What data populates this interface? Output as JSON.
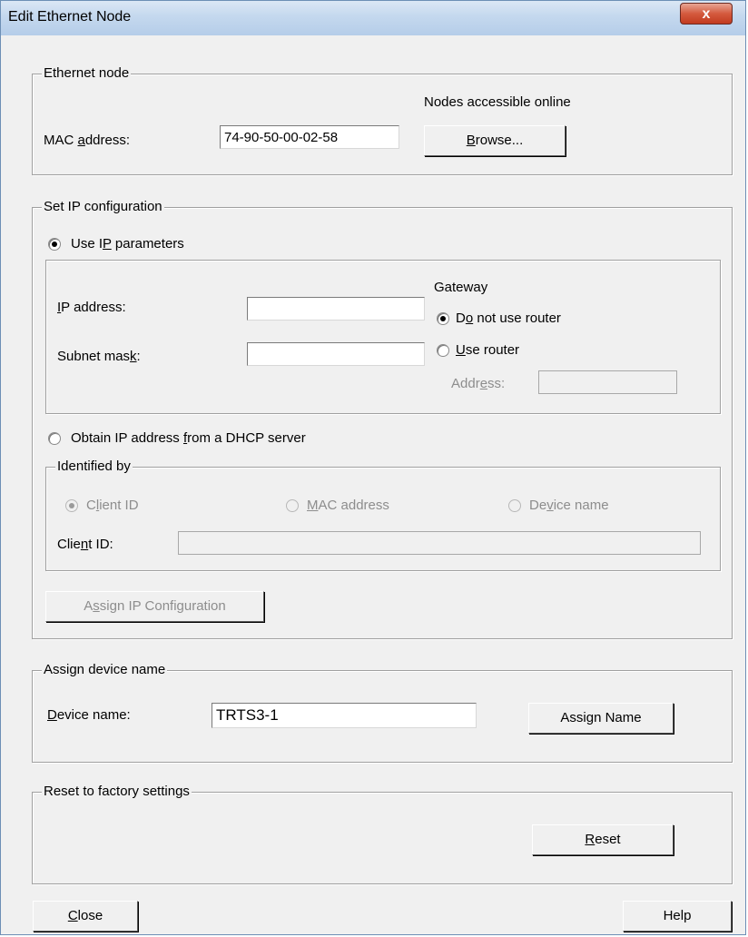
{
  "window": {
    "title": "Edit Ethernet Node",
    "close_label": "x"
  },
  "ethernet_node": {
    "legend": "Ethernet node",
    "nodes_online_label": "Nodes accessible online",
    "mac_label_pre": "MAC ",
    "mac_label_key": "a",
    "mac_label_post": "ddress:",
    "mac_value": "74-90-50-00-02-58",
    "browse_key": "B",
    "browse_rest": "rowse..."
  },
  "ip_config": {
    "legend": "Set IP configuration",
    "use_ip_pre": "Use I",
    "use_ip_key": "P",
    "use_ip_post": " parameters",
    "ip_address_key": "I",
    "ip_address_rest": "P address:",
    "ip_address_value": "",
    "subnet_pre": "Subnet mas",
    "subnet_key": "k",
    "subnet_post": ":",
    "subnet_value": "",
    "gateway_label": "Gateway",
    "no_router_pre": "D",
    "no_router_key": "o",
    "no_router_post": " not use router",
    "use_router_key": "U",
    "use_router_rest": "se router",
    "address_pre": "Addr",
    "address_key": "e",
    "address_post": "ss:",
    "address_value": "",
    "dhcp_pre": "Obtain IP address ",
    "dhcp_key": "f",
    "dhcp_post": "rom a DHCP server",
    "identified_by_legend": "Identified by",
    "client_id_opt_pre": "C",
    "client_id_opt_key": "l",
    "client_id_opt_post": "ient ID",
    "mac_opt_key": "M",
    "mac_opt_rest": "AC address",
    "device_opt_pre": "De",
    "device_opt_key": "v",
    "device_opt_post": "ice name",
    "client_id_label_pre": "Clie",
    "client_id_label_key": "n",
    "client_id_label_post": "t ID:",
    "client_id_value": "",
    "assign_ip_pre": "A",
    "assign_ip_key": "s",
    "assign_ip_post": "sign IP Configuration"
  },
  "device_name": {
    "legend": "Assign device name",
    "label_key": "D",
    "label_rest": "evice name:",
    "value": "TRTS3-1",
    "assign_pre": "Assi",
    "assign_key": "g",
    "assign_post": "n Name"
  },
  "reset": {
    "legend": "Reset to factory settings",
    "reset_key": "R",
    "reset_rest": "eset"
  },
  "footer": {
    "close_key": "C",
    "close_rest": "lose",
    "help_label": "Help"
  }
}
